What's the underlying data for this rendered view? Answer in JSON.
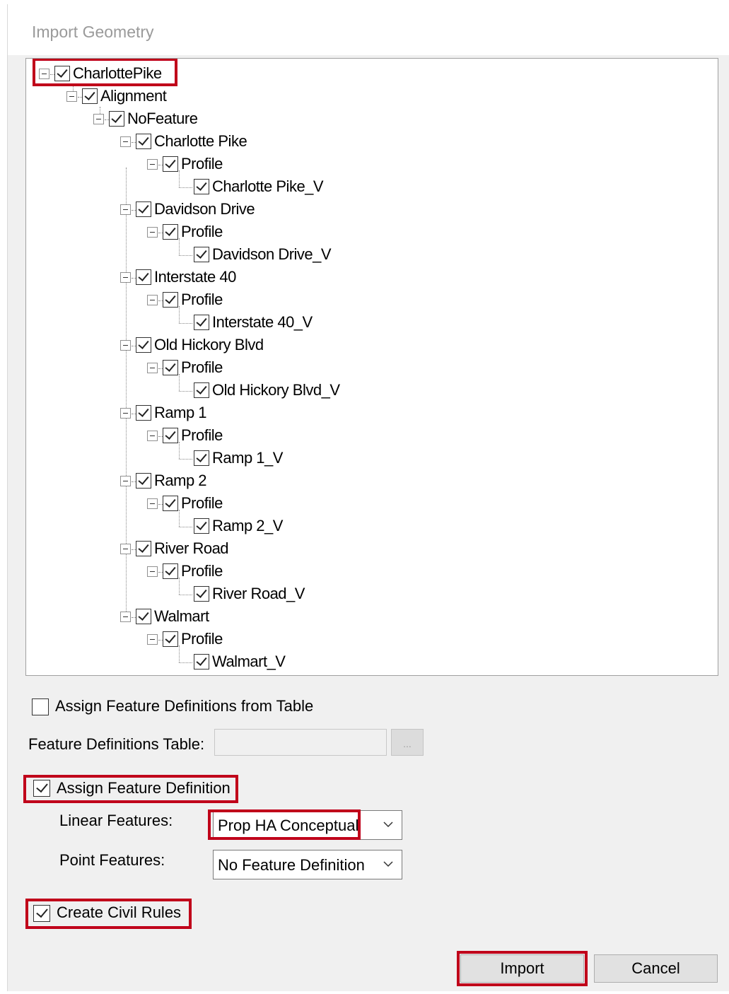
{
  "window": {
    "title": "Import Geometry"
  },
  "tree": {
    "root": "CharlottePike",
    "alignment": "Alignment",
    "no_feature": "NoFeature",
    "profile_label": "Profile",
    "items": [
      {
        "name": "Charlotte Pike",
        "profile": "Profile",
        "child": "Charlotte Pike_V"
      },
      {
        "name": "Davidson Drive",
        "profile": "Profile",
        "child": "Davidson Drive_V"
      },
      {
        "name": "Interstate 40",
        "profile": "Profile",
        "child": "Interstate 40_V"
      },
      {
        "name": "Old Hickory Blvd",
        "profile": "Profile",
        "child": "Old Hickory Blvd_V"
      },
      {
        "name": "Ramp 1",
        "profile": "Profile",
        "child": "Ramp 1_V"
      },
      {
        "name": "Ramp 2",
        "profile": "Profile",
        "child": "Ramp 2_V"
      },
      {
        "name": "River Road",
        "profile": "Profile",
        "child": "River Road_V"
      },
      {
        "name": "Walmart",
        "profile": "Profile",
        "child": "Walmart_V"
      }
    ]
  },
  "options": {
    "assign_from_table": {
      "label": "Assign Feature Definitions from Table",
      "checked": false
    },
    "table_label": "Feature Definitions Table:",
    "table_value": "",
    "browse_label": "...",
    "assign_feature_definition": {
      "label": "Assign Feature Definition",
      "checked": true
    },
    "linear_label": "Linear Features:",
    "linear_value": "Prop HA Conceptual",
    "point_label": "Point Features:",
    "point_value": "No Feature Definition",
    "create_civil_rules": {
      "label": "Create Civil Rules",
      "checked": true
    }
  },
  "buttons": {
    "import": "Import",
    "cancel": "Cancel"
  },
  "colors": {
    "highlight": "#c0001a",
    "background": "#f0f0f0"
  }
}
